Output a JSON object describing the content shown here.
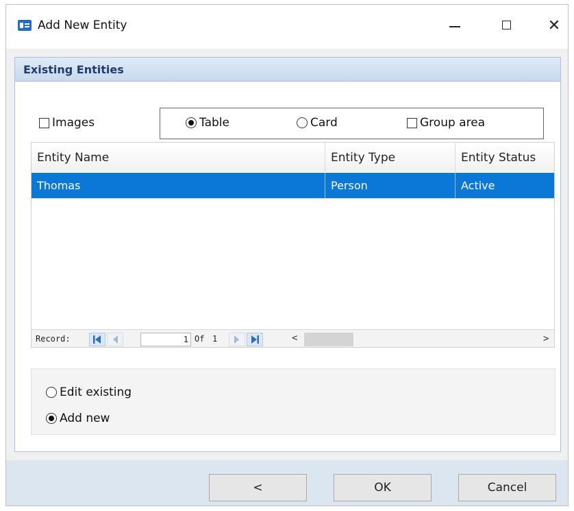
{
  "window": {
    "title": "Add New Entity",
    "minimize_glyph": "",
    "close_glyph": "✕"
  },
  "section": {
    "title": "Existing Entities"
  },
  "options": {
    "images_label": "Images",
    "images_checked": false,
    "view_modes": [
      {
        "label": "Table",
        "selected": true
      },
      {
        "label": "Card",
        "selected": false
      }
    ],
    "group_area_label": "Group area",
    "group_area_checked": false
  },
  "grid": {
    "columns": [
      "Entity Name",
      "Entity Type",
      "Entity Status"
    ],
    "rows": [
      {
        "name": "Thomas",
        "type": "Person",
        "status": "Active",
        "selected": true
      }
    ],
    "selection_color": "#0b77d6"
  },
  "record_nav": {
    "label": "Record:",
    "current": "1",
    "of_label": "Of",
    "total": "1",
    "scroll_left": "<",
    "scroll_right": ">"
  },
  "mode": {
    "options": [
      {
        "label": "Edit existing",
        "selected": false
      },
      {
        "label": "Add new",
        "selected": true
      }
    ]
  },
  "footer": {
    "back_label": "<",
    "ok_label": "OK",
    "cancel_label": "Cancel"
  },
  "colors": {
    "header_bg": "#c7d9ee",
    "header_text": "#1f3c6a",
    "footer_bg": "#dce6f1"
  }
}
